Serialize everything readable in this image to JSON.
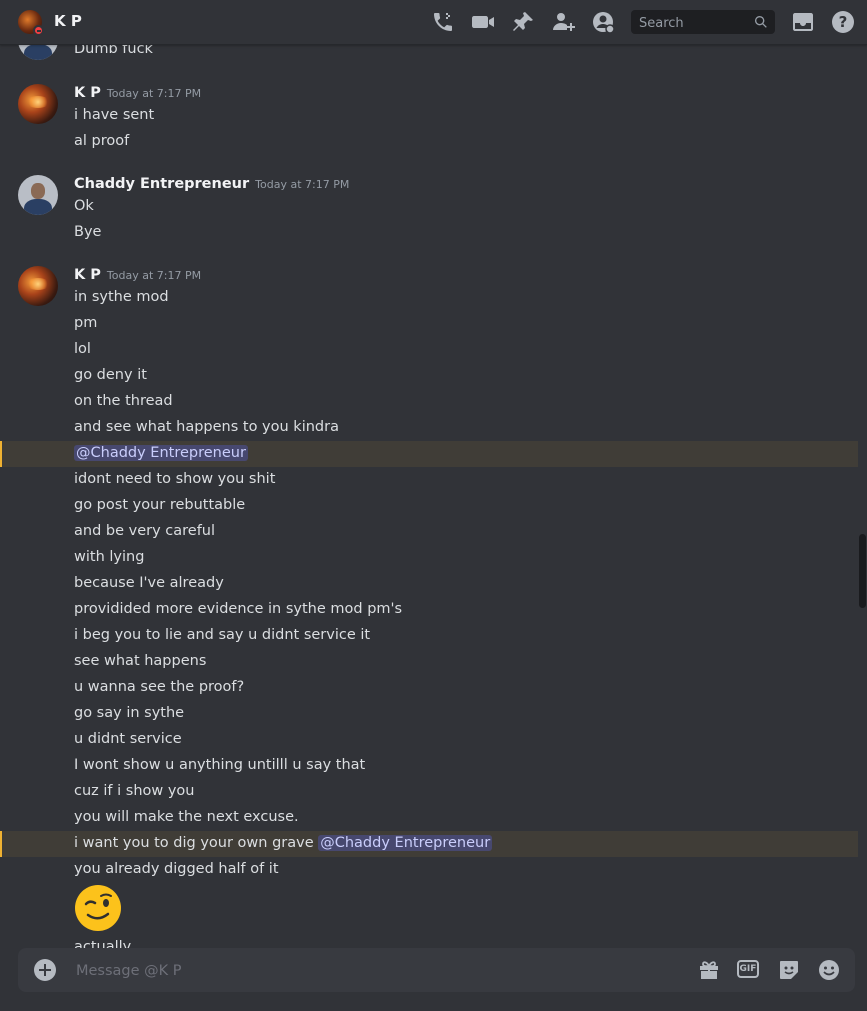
{
  "header": {
    "title": "K P",
    "search_placeholder": "Search",
    "icons": [
      "call-icon",
      "video-call-icon",
      "pin-icon",
      "add-friend-icon",
      "profile-icon",
      "inbox-icon",
      "help-icon"
    ]
  },
  "messages": {
    "top_partial": "Dumb fuck",
    "groups": [
      {
        "author": "K P",
        "timestamp": "Today at 7:17 PM",
        "lines": [
          "i have sent",
          "al proof"
        ]
      },
      {
        "author": "Chaddy Entrepreneur",
        "timestamp": "Today at 7:17 PM",
        "lines": [
          "Ok",
          "Bye"
        ]
      },
      {
        "author": "K P",
        "timestamp": "Today at 7:17 PM",
        "lines": [
          "in sythe mod",
          "pm",
          "lol",
          "go deny it",
          "on the thread",
          "and see what happens to you kindra",
          "@Chaddy Entrepreneur",
          "idont need to show you shit",
          "go post your rebuttable",
          "and be very careful",
          "with lying",
          "because I've already",
          "providided more evidence in sythe mod pm's",
          "i beg you to lie and say u didnt service it",
          "see what happens",
          "u wanna see the proof?",
          "go say in sythe",
          "u didnt service",
          "I wont show u anything untilll u say that",
          "cuz if i show you",
          "you will make the next excuse.",
          "i want you to dig your own grave ",
          "@Chaddy Entrepreneur",
          "you already digged half of it",
          "actually"
        ]
      }
    ],
    "emoji": "winking-face-emoji"
  },
  "composer": {
    "placeholder": "Message @K P",
    "icons": [
      "gift-icon",
      "gif-icon",
      "sticker-icon",
      "emoji-icon"
    ],
    "gif_label": "GIF"
  },
  "colors": {
    "background": "#313338",
    "mention_bg": "#3c4270",
    "mention_text": "#c9cdfb",
    "highlight_border": "#f0b232"
  }
}
